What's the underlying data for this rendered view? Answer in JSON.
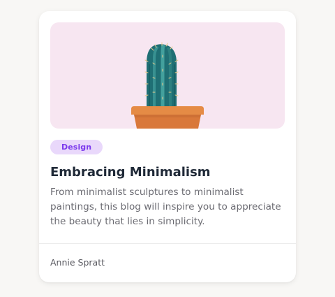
{
  "card": {
    "tag_label": "Design",
    "title": "Embracing Minimalism",
    "description": "From minimalist sculptures to minimalist paintings, this blog will inspire you to appreciate the beauty that lies in simplicity.",
    "author": "Annie Spratt",
    "image": {
      "subject": "cactus-in-terracotta-pot",
      "background_color": "#f7e6f1"
    }
  },
  "colors": {
    "page_background": "#f8f7f5",
    "card_background": "#ffffff",
    "tag_background": "#e9d8fb",
    "tag_text": "#7c3aed",
    "title_text": "#1f2937",
    "body_text": "#6b6b72"
  }
}
